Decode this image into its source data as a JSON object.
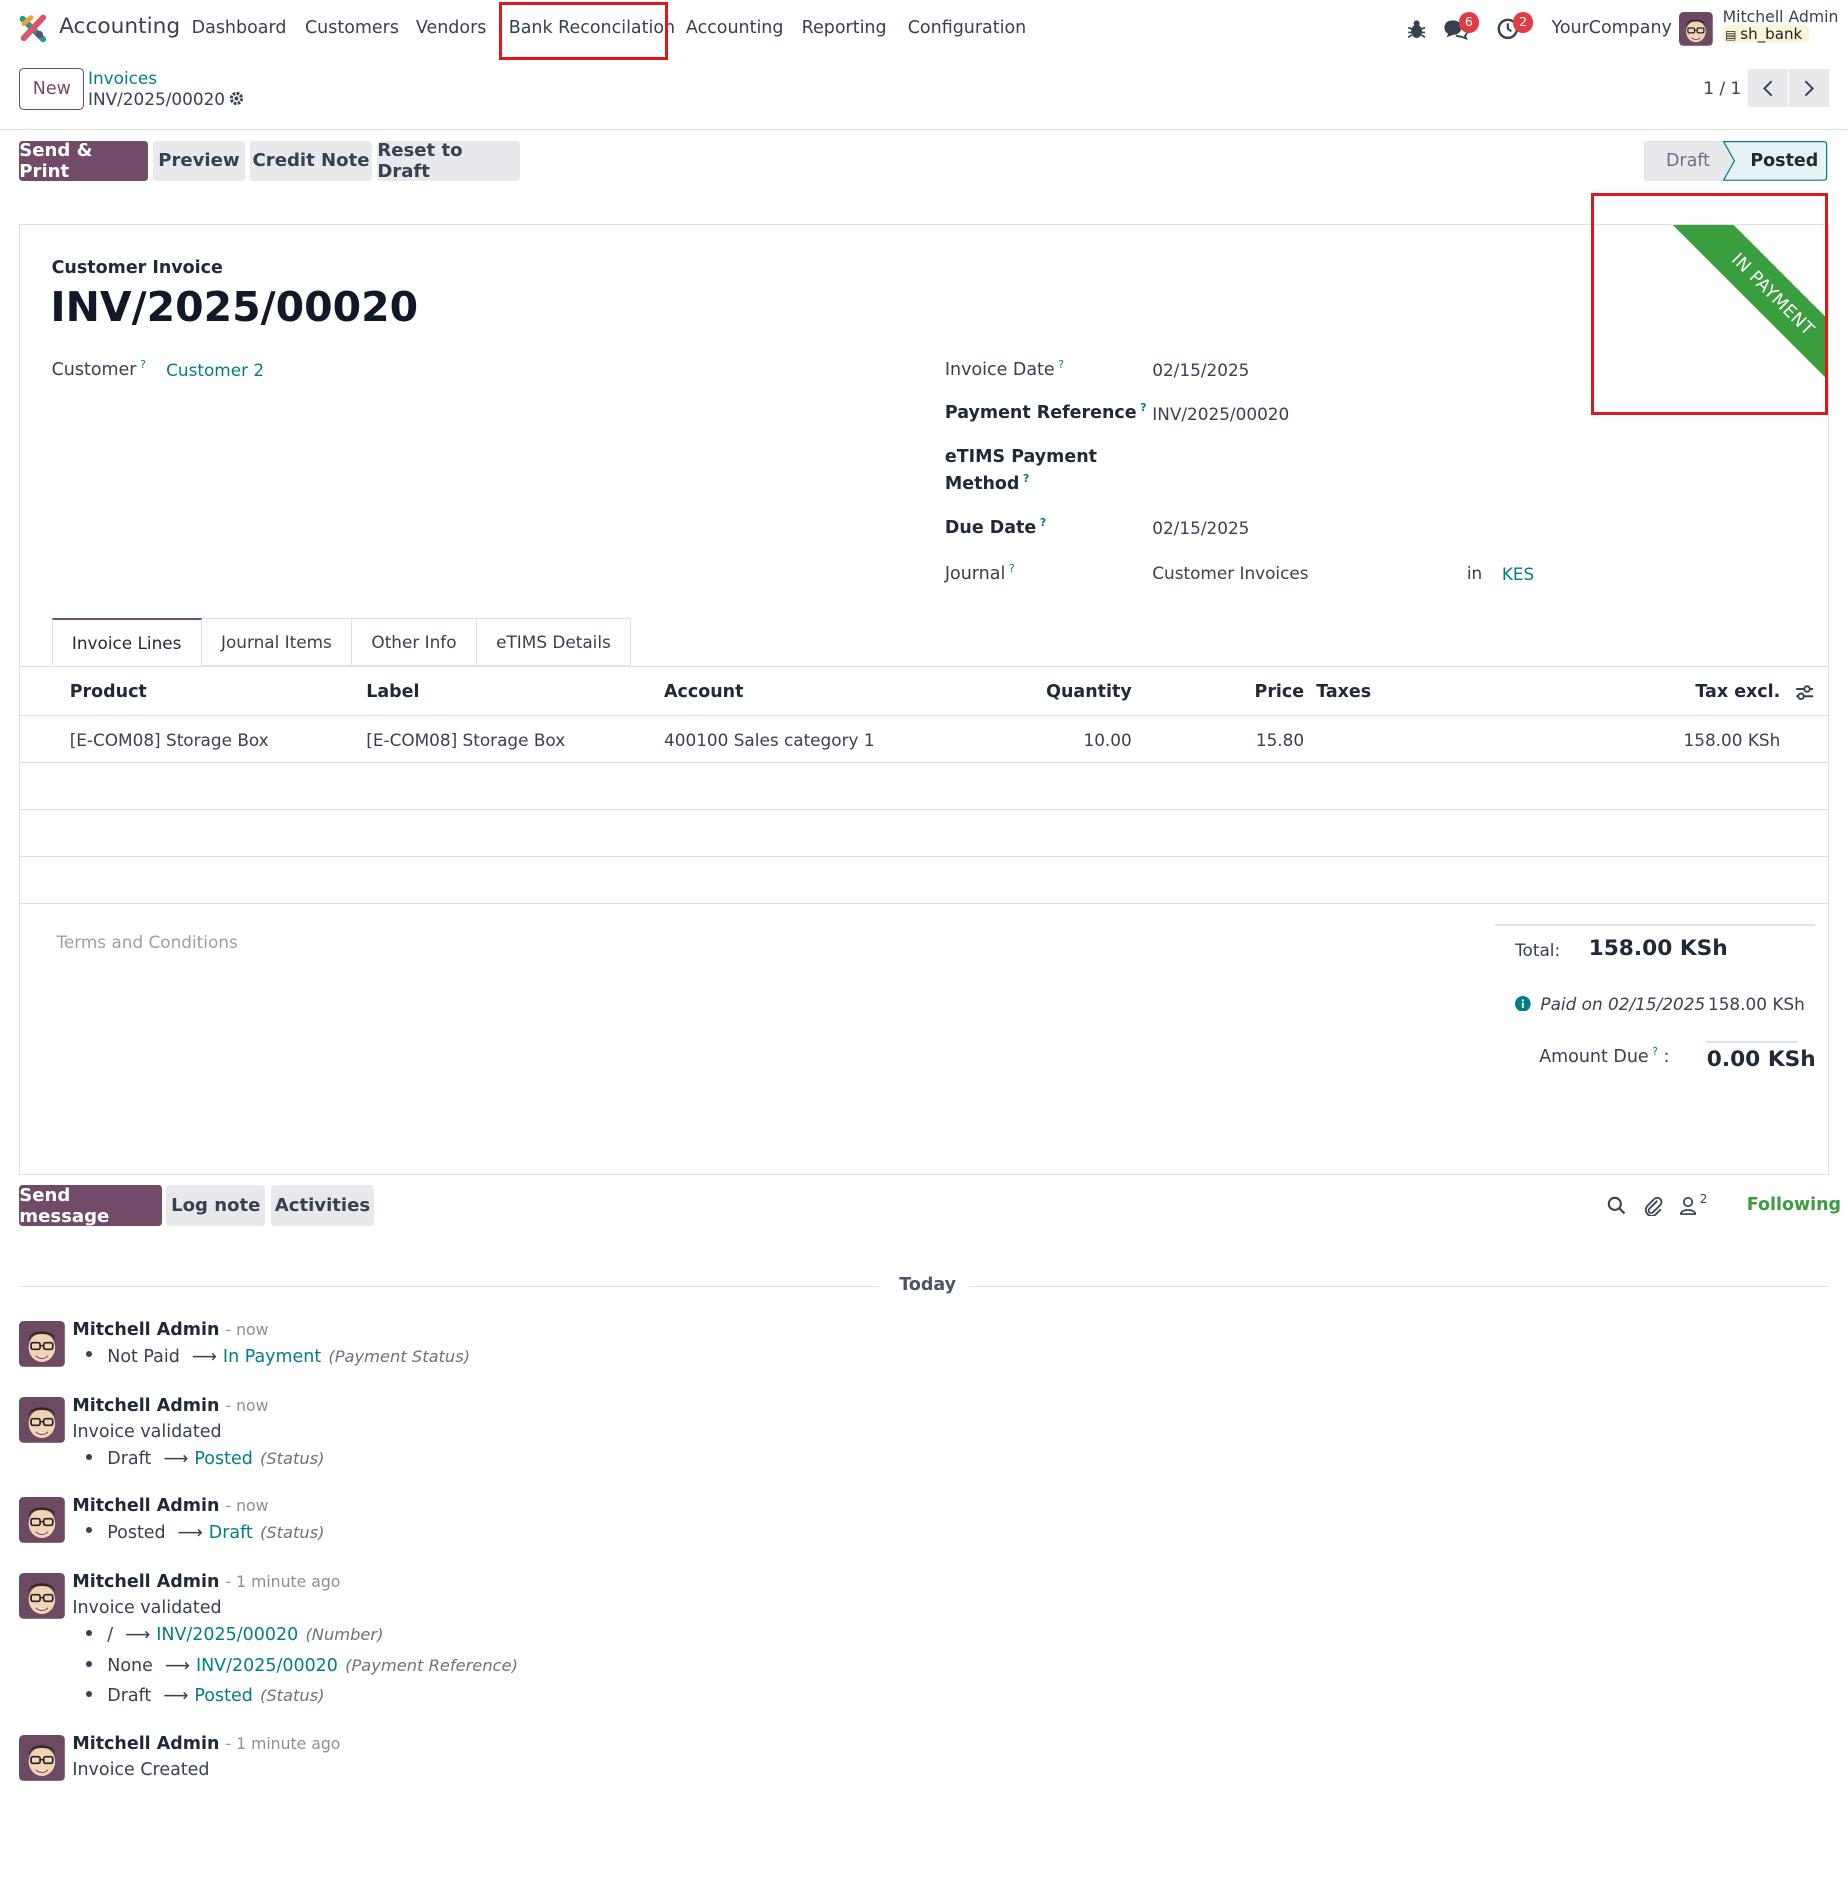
{
  "nav": {
    "app_name": "Accounting",
    "menu": [
      "Dashboard",
      "Customers",
      "Vendors",
      "Bank Reconcilation",
      "Accounting",
      "Reporting",
      "Configuration"
    ],
    "messages_count": "6",
    "activities_count": "2",
    "company": "YourCompany",
    "user_name": "Mitchell Admin",
    "db_name": "sh_bank"
  },
  "control": {
    "new_label": "New",
    "breadcrumb_parent": "Invoices",
    "breadcrumb_current": "INV/2025/00020",
    "pager": "1 / 1"
  },
  "actions": {
    "send_print": "Send & Print",
    "preview": "Preview",
    "credit_note": "Credit Note",
    "reset_draft": "Reset to Draft"
  },
  "status": {
    "draft": "Draft",
    "posted": "Posted",
    "current": "Posted"
  },
  "invoice": {
    "type_label": "Customer Invoice",
    "number": "INV/2025/00020",
    "ribbon": "IN PAYMENT",
    "customer_label": "Customer",
    "customer": "Customer 2",
    "invoice_date_label": "Invoice Date",
    "invoice_date": "02/15/2025",
    "payment_ref_label": "Payment Reference",
    "payment_ref": "INV/2025/00020",
    "etims_label_1": "eTIMS Payment",
    "etims_label_2": "Method",
    "due_date_label": "Due Date",
    "due_date": "02/15/2025",
    "journal_label": "Journal",
    "journal": "Customer Invoices",
    "in_label": "in",
    "currency": "KES"
  },
  "tabs": [
    "Invoice Lines",
    "Journal Items",
    "Other Info",
    "eTIMS Details"
  ],
  "lines": {
    "headers": {
      "product": "Product",
      "label": "Label",
      "account": "Account",
      "quantity": "Quantity",
      "price": "Price",
      "taxes": "Taxes",
      "tax_excl": "Tax excl."
    },
    "rows": [
      {
        "product": "[E-COM08] Storage Box",
        "label": "[E-COM08] Storage Box",
        "account": "400100 Sales category 1",
        "quantity": "10.00",
        "price": "15.80",
        "taxes": "",
        "tax_excl": "158.00 KSh"
      }
    ]
  },
  "terms_placeholder": "Terms and Conditions",
  "totals": {
    "total_label": "Total:",
    "total": "158.00 KSh",
    "paid_label": "Paid on 02/15/2025",
    "paid": "158.00 KSh",
    "amount_due_label": "Amount Due",
    "amount_due": "0.00 KSh"
  },
  "chatter": {
    "send_message": "Send message",
    "log_note": "Log note",
    "activities": "Activities",
    "followers_count": "2",
    "following": "Following",
    "today": "Today",
    "messages": [
      {
        "author": "Mitchell Admin",
        "time": "- now",
        "text": "",
        "changes": [
          {
            "old": "Not Paid",
            "new": "In Payment",
            "field": "(Payment Status)"
          }
        ]
      },
      {
        "author": "Mitchell Admin",
        "time": "- now",
        "text": "Invoice validated",
        "changes": [
          {
            "old": "Draft",
            "new": "Posted",
            "field": "(Status)"
          }
        ]
      },
      {
        "author": "Mitchell Admin",
        "time": "- now",
        "text": "",
        "changes": [
          {
            "old": "Posted",
            "new": "Draft",
            "field": "(Status)"
          }
        ]
      },
      {
        "author": "Mitchell Admin",
        "time": "- 1 minute ago",
        "text": "Invoice validated",
        "changes": [
          {
            "old": "/",
            "new": "INV/2025/00020",
            "field": "(Number)"
          },
          {
            "old": "None",
            "new": "INV/2025/00020",
            "field": "(Payment Reference)"
          },
          {
            "old": "Draft",
            "new": "Posted",
            "field": "(Status)"
          }
        ]
      },
      {
        "author": "Mitchell Admin",
        "time": "- 1 minute ago",
        "text": "Invoice Created",
        "changes": []
      }
    ]
  },
  "colors": {
    "primary": "#714b67",
    "link": "#017e84",
    "ribbon": "#3a9d3e",
    "highlight": "#e0161a",
    "badge": "#e03b45"
  }
}
